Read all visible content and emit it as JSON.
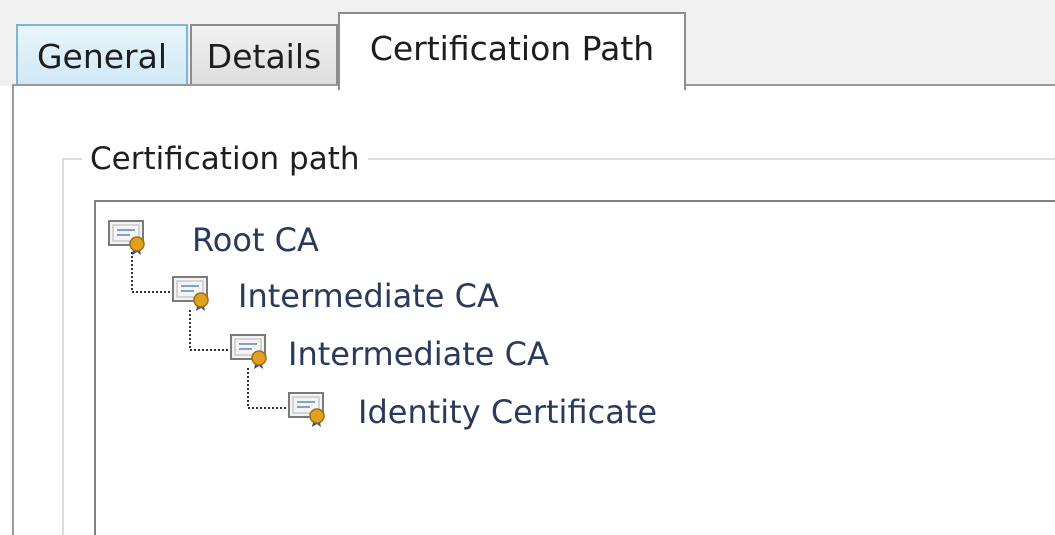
{
  "tabs": [
    {
      "label": "General",
      "selected": false
    },
    {
      "label": "Details",
      "selected": false
    },
    {
      "label": "Certification Path",
      "selected": true
    }
  ],
  "group": {
    "title": "Certification path"
  },
  "tree": {
    "nodes": [
      {
        "label": "Root CA",
        "icon": "certificate-icon",
        "level": 0
      },
      {
        "label": "Intermediate CA",
        "icon": "certificate-icon",
        "level": 1
      },
      {
        "label": "Intermediate CA",
        "icon": "certificate-icon",
        "level": 2
      },
      {
        "label": "Identity Certificate",
        "icon": "certificate-icon",
        "level": 3
      }
    ]
  },
  "colors": {
    "selected_tab_bg": "#ffffff",
    "general_tab_tint": "#cfe8f6",
    "node_text": "#2a3a5c",
    "seal_gold": "#e0a020"
  }
}
